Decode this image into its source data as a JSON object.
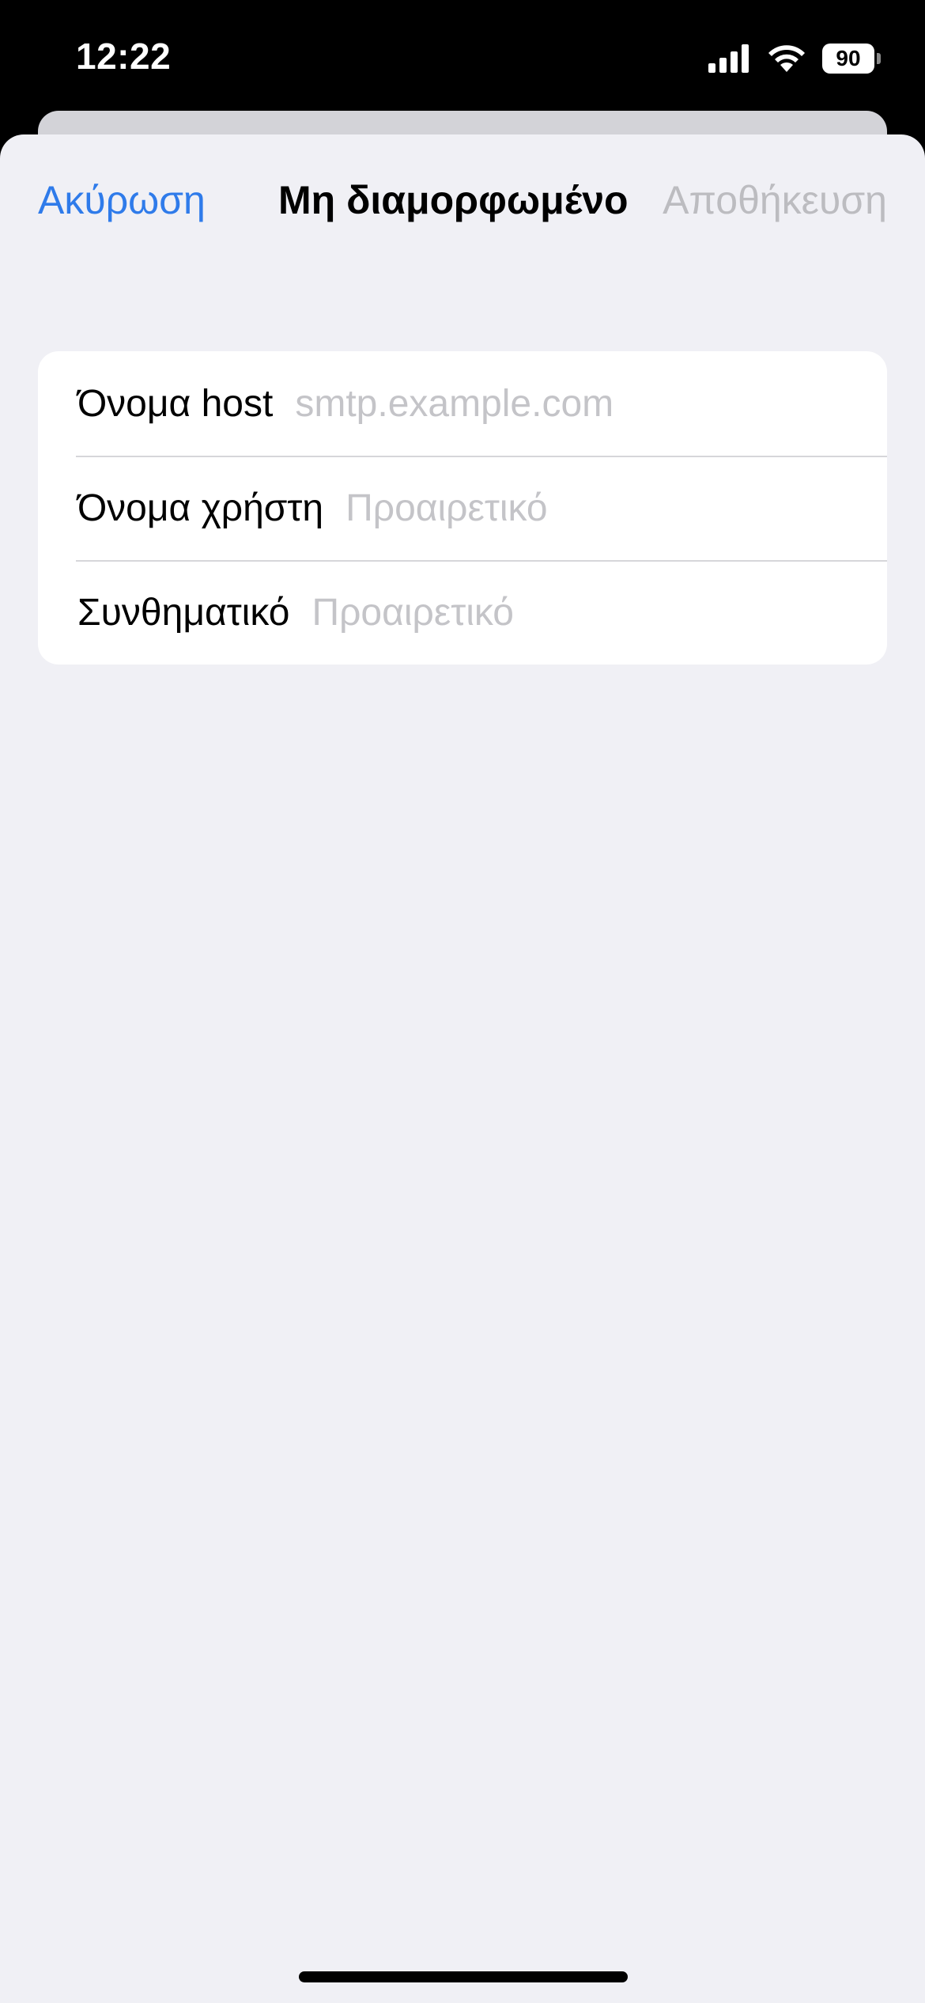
{
  "status_bar": {
    "time": "12:22",
    "battery_level": "90",
    "icons": [
      "cellular-signal-icon",
      "wifi-icon",
      "battery-icon"
    ]
  },
  "nav": {
    "cancel_label": "Ακύρωση",
    "title": "Μη διαμορφωμένο",
    "save_label": "Αποθήκευση"
  },
  "form": {
    "fields": [
      {
        "label": "Όνομα host",
        "value": "",
        "placeholder": "smtp.example.com"
      },
      {
        "label": "Όνομα χρήστη",
        "value": "",
        "placeholder": "Προαιρετικό"
      },
      {
        "label": "Συνθηματικό",
        "value": "",
        "placeholder": "Προαιρετικό"
      }
    ]
  },
  "colors": {
    "accent": "#2f7bea",
    "disabled": "#bcbcc0",
    "sheet_background": "#f0f0f5",
    "placeholder": "#c4c4c8"
  }
}
